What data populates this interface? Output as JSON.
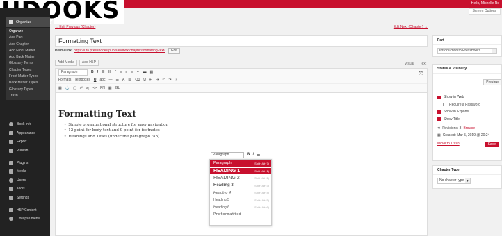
{
  "app": {
    "logo_text": "UDOOKS",
    "greeting": "Hello, Michelle Re",
    "screen_options": "Screen Options"
  },
  "sidebar": {
    "section": "Organize",
    "sub_items": [
      "Organize",
      "Add Part",
      "Add Chapter",
      "Add Front Matter",
      "Add Back Matter",
      "Glossary Terms",
      "Chapter Types",
      "Front Matter Types",
      "Back Matter Types",
      "Glossary Types",
      "Trash"
    ],
    "main_items": [
      {
        "label": "Book Info",
        "icon": "info-icon"
      },
      {
        "label": "Appearance",
        "icon": "paintbrush-icon"
      },
      {
        "label": "Export",
        "icon": "export-icon"
      },
      {
        "label": "Publish",
        "icon": "publish-icon"
      },
      {
        "label": "Plugins",
        "icon": "plugin-icon"
      },
      {
        "label": "Media",
        "icon": "media-icon"
      },
      {
        "label": "Users",
        "icon": "users-icon"
      },
      {
        "label": "Tools",
        "icon": "wrench-icon"
      },
      {
        "label": "Settings",
        "icon": "settings-icon"
      },
      {
        "label": "H5P Content",
        "icon": "h5p-icon"
      },
      {
        "label": "Collapse menu",
        "icon": "collapse-icon"
      }
    ]
  },
  "nav": {
    "prev": "← Edit Previous (Chapter)",
    "next": "Edit Next (Chapter) →"
  },
  "post": {
    "title": "Formatting Text",
    "permalink_label": "Permalink:",
    "permalink_url": "https://uta.pressbooks.pub/sandbox/chapter/formatting-text/",
    "edit_button": "Edit"
  },
  "media": {
    "add_media": "Add Media",
    "add_h5p": "Add H5P",
    "visual_tab": "Visual",
    "text_tab": "Text"
  },
  "toolbar": {
    "format_select": "Paragraph",
    "formats": "Formats",
    "textboxes": "Textboxes"
  },
  "content": {
    "heading": "Formatting Text",
    "bullets": [
      "Simple organizational structure for easy navigation",
      "12 point for body text and 9 point for footnotes",
      "Headings and Titles (under the paragraph tab)"
    ]
  },
  "format_menu": {
    "select_label": "Paragraph",
    "items": [
      {
        "label": "Paragraph",
        "shortcut": "(Shift+Alt+7)"
      },
      {
        "label": "HEADING 1",
        "shortcut": "(Shift+Alt+1)"
      },
      {
        "label": "HEADING 2",
        "shortcut": "(Shift+Alt+2)"
      },
      {
        "label": "Heading 3",
        "shortcut": "(Shift+Alt+3)"
      },
      {
        "label": "Heading 4",
        "shortcut": "(Shift+Alt+4)"
      },
      {
        "label": "Heading 5",
        "shortcut": "(Shift+Alt+5)"
      },
      {
        "label": "Heading 6",
        "shortcut": "(Shift+Alt+6)"
      },
      {
        "label": "Preformatted",
        "shortcut": ""
      }
    ]
  },
  "part_panel": {
    "title": "Part",
    "value": "Introduction to Pressbooks"
  },
  "status_panel": {
    "title": "Status & Visibility",
    "preview": "Preview",
    "show_web": "Show in Web",
    "require_password": "Require a Password",
    "show_exports": "Show in Exports",
    "show_title": "Show Title",
    "revisions_label": "Revisions: 3",
    "revisions_link": "Browse",
    "created": "Created: Mar 5, 2019 @ 20:24",
    "trash": "Move to Trash",
    "save": "Save"
  },
  "chapter_type_panel": {
    "title": "Chapter Type",
    "value": "No chapter type"
  },
  "colors": {
    "accent": "#c8102e",
    "sidebar": "#222222"
  }
}
